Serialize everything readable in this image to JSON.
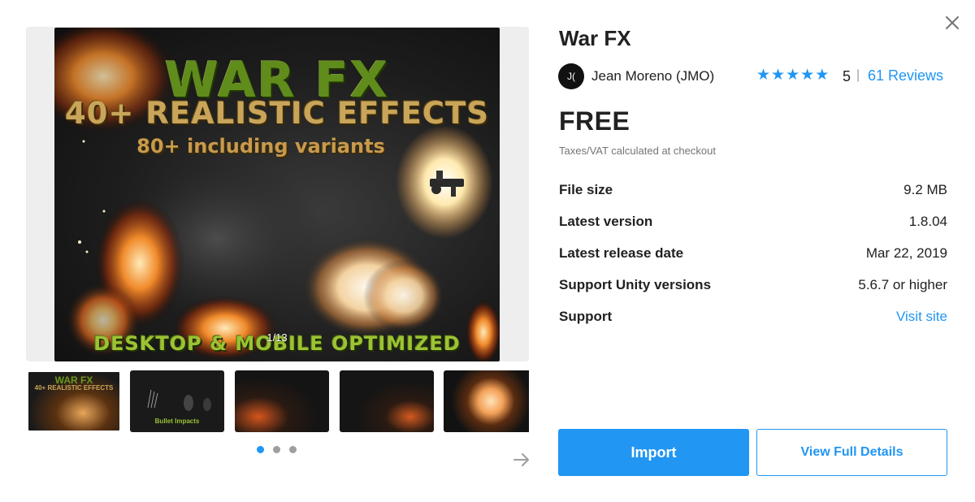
{
  "dialog": {
    "close_icon": "close-icon"
  },
  "gallery": {
    "hero_title": "WAR FX",
    "hero_subtitle": "40+ REALISTIC EFFECTS",
    "hero_tagline": "80+ including variants",
    "hero_footer": "DESKTOP & MOBILE OPTIMIZED",
    "counter": "1/13",
    "thumbnail_1_title": "WAR FX",
    "thumbnail_1_subtitle": "40+ REALISTIC EFFECTS",
    "thumbnail_2_caption": "Bullet Impacts",
    "dots": 3,
    "active_dot": 0,
    "next_icon": "arrow-right-icon"
  },
  "product": {
    "title": "War FX",
    "publisher_avatar": "J(",
    "publisher": "Jean Moreno (JMO)",
    "rating": "5",
    "rating_stars": 5,
    "rating_separator": "|",
    "reviews": "61 Reviews",
    "price": "FREE",
    "tax_note": "Taxes/VAT calculated at checkout"
  },
  "specs": [
    {
      "label": "File size",
      "value": "9.2 MB"
    },
    {
      "label": "Latest version",
      "value": "1.8.04"
    },
    {
      "label": "Latest release date",
      "value": "Mar 22, 2019"
    },
    {
      "label": "Support Unity versions",
      "value": "5.6.7 or higher"
    },
    {
      "label": "Support",
      "value": "Visit site"
    }
  ],
  "actions": {
    "import_label": "Import",
    "details_label": "View Full Details"
  },
  "colors": {
    "accent": "#2196f3",
    "text": "#212121",
    "muted": "#757575"
  }
}
